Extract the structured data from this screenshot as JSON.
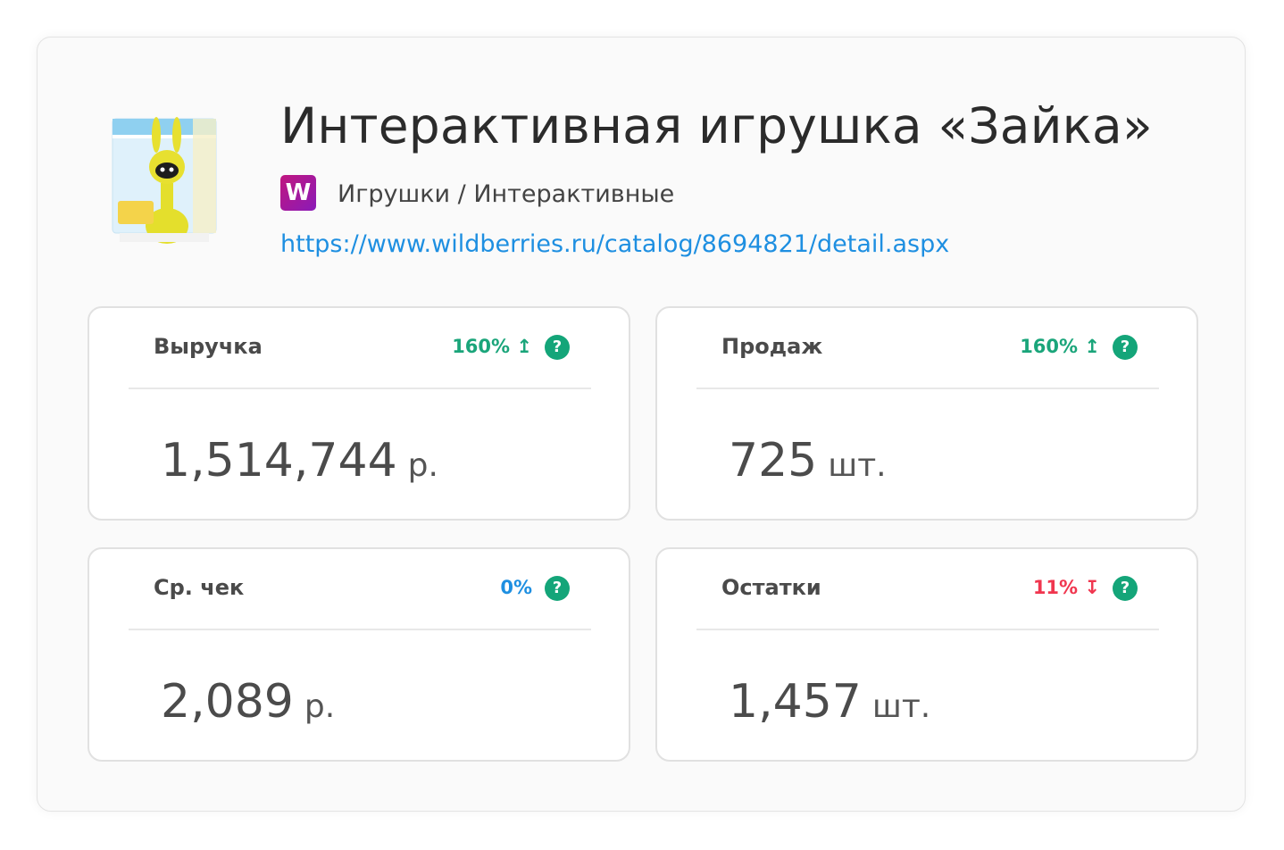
{
  "product": {
    "title": "Интерактивная игрушка «Зайка»",
    "marketplace_logo": "W",
    "category": "Игрушки / Интерактивные",
    "url": "https://www.wildberries.ru/catalog/8694821/detail.aspx",
    "image_icon": "toy-bunny-box-image"
  },
  "metrics": [
    {
      "label": "Выручка",
      "change": "160%",
      "trend": "up",
      "trend_glyph": "↥",
      "value": "1,514,744",
      "unit": "р."
    },
    {
      "label": "Продаж",
      "change": "160%",
      "trend": "up",
      "trend_glyph": "↥",
      "value": "725",
      "unit": "шт."
    },
    {
      "label": "Ср. чек",
      "change": "0%",
      "trend": "neutral",
      "trend_glyph": "",
      "value": "2,089",
      "unit": "р."
    },
    {
      "label": "Остатки",
      "change": "11%",
      "trend": "down",
      "trend_glyph": "↧",
      "value": "1,457",
      "unit": "шт."
    }
  ],
  "help_glyph": "?",
  "colors": {
    "up": "#1aa57a",
    "down": "#f0364f",
    "neutral": "#1e8fe1",
    "link": "#1e8fe1",
    "help_icon": "#14a579",
    "logo_gradient_start": "#c0167f",
    "logo_gradient_end": "#8a1bb8"
  }
}
